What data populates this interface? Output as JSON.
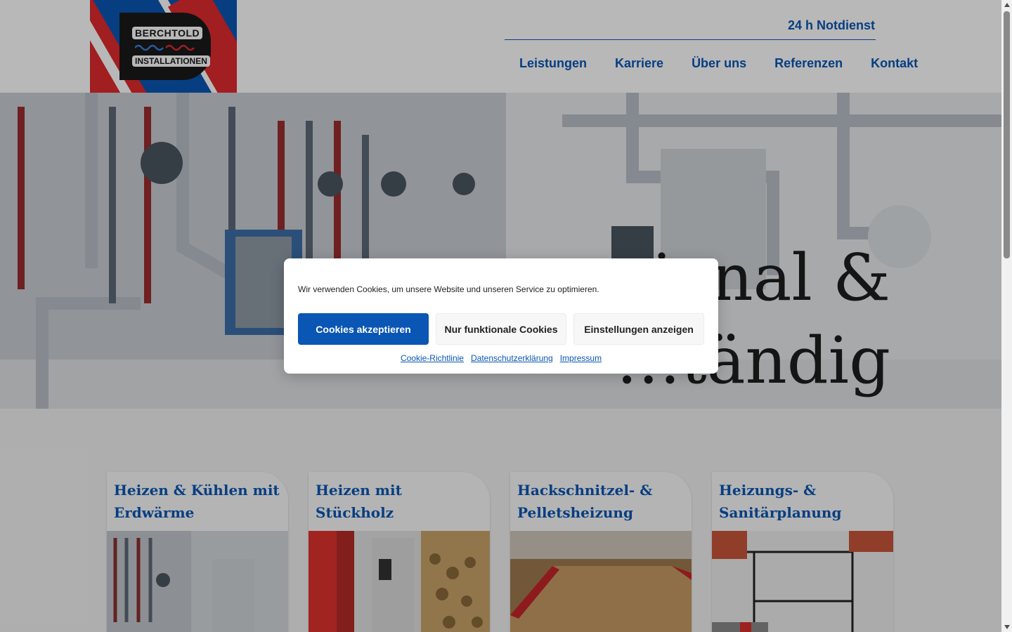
{
  "header": {
    "logo": {
      "line1": "BERCHTOLD",
      "line2": "INSTALLATIONEN"
    },
    "notdienst": "24 h Notdienst",
    "nav": [
      "Leistungen",
      "Karriere",
      "Über uns",
      "Referenzen",
      "Kontakt"
    ]
  },
  "hero": {
    "title_line1": "…ional &",
    "title_line2": "…tändig"
  },
  "cards": [
    {
      "title": "Heizen  & Kühlen mit Erdwärme"
    },
    {
      "title": "Heizen mit Stückholz"
    },
    {
      "title": "Hackschnitzel- & Pelletsheizung"
    },
    {
      "title": "Heizungs- & Sanitärplanung"
    }
  ],
  "cookie_banner": {
    "message": "Wir verwenden Cookies, um unsere Website und unseren Service zu optimieren.",
    "accept_label": "Cookies akzeptieren",
    "functional_label": "Nur funktionale Cookies",
    "settings_label": "Einstellungen anzeigen",
    "links": [
      "Cookie-Richtlinie",
      "Datenschutzerklärung",
      "Impressum"
    ]
  },
  "colors": {
    "brand_blue": "#0a56b4",
    "brand_red": "#e02a2f"
  }
}
